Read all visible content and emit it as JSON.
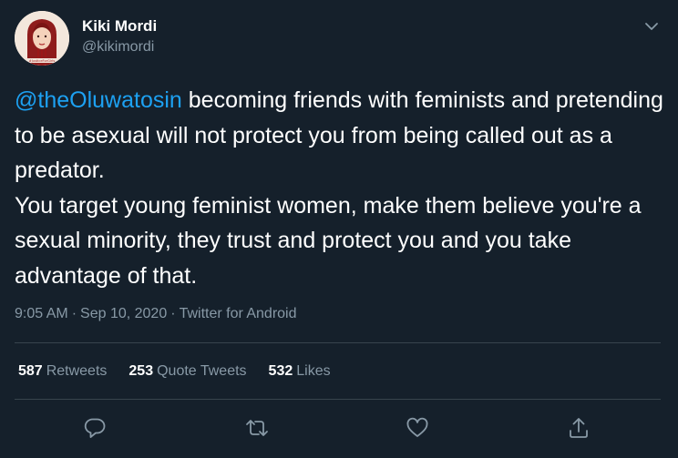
{
  "author": {
    "name": "Kiki Mordi",
    "handle": "@kikimordi",
    "avatar_badge": "#JusticeForGirls"
  },
  "tweet": {
    "mention": "@theOluwatosin",
    "text": " becoming friends with feminists and pretending to be asexual will not protect you from being called out as a predator.\nYou target young feminist women, make them believe you're a sexual minority, they trust and protect you and you take advantage of that.",
    "time": "9:05 AM",
    "date": "Sep 10, 2020",
    "source": "Twitter for Android"
  },
  "stats": {
    "retweets": {
      "count": "587",
      "label": "Retweets"
    },
    "quote_tweets": {
      "count": "253",
      "label": "Quote Tweets"
    },
    "likes": {
      "count": "532",
      "label": "Likes"
    }
  },
  "icons": {
    "more": "chevron-down-icon",
    "reply": "reply-icon",
    "retweet": "retweet-icon",
    "like": "heart-icon",
    "share": "share-icon"
  },
  "colors": {
    "background": "#15202b",
    "text": "#ffffff",
    "secondary": "#8899a6",
    "link": "#1da1f2",
    "divider": "#38444d"
  }
}
